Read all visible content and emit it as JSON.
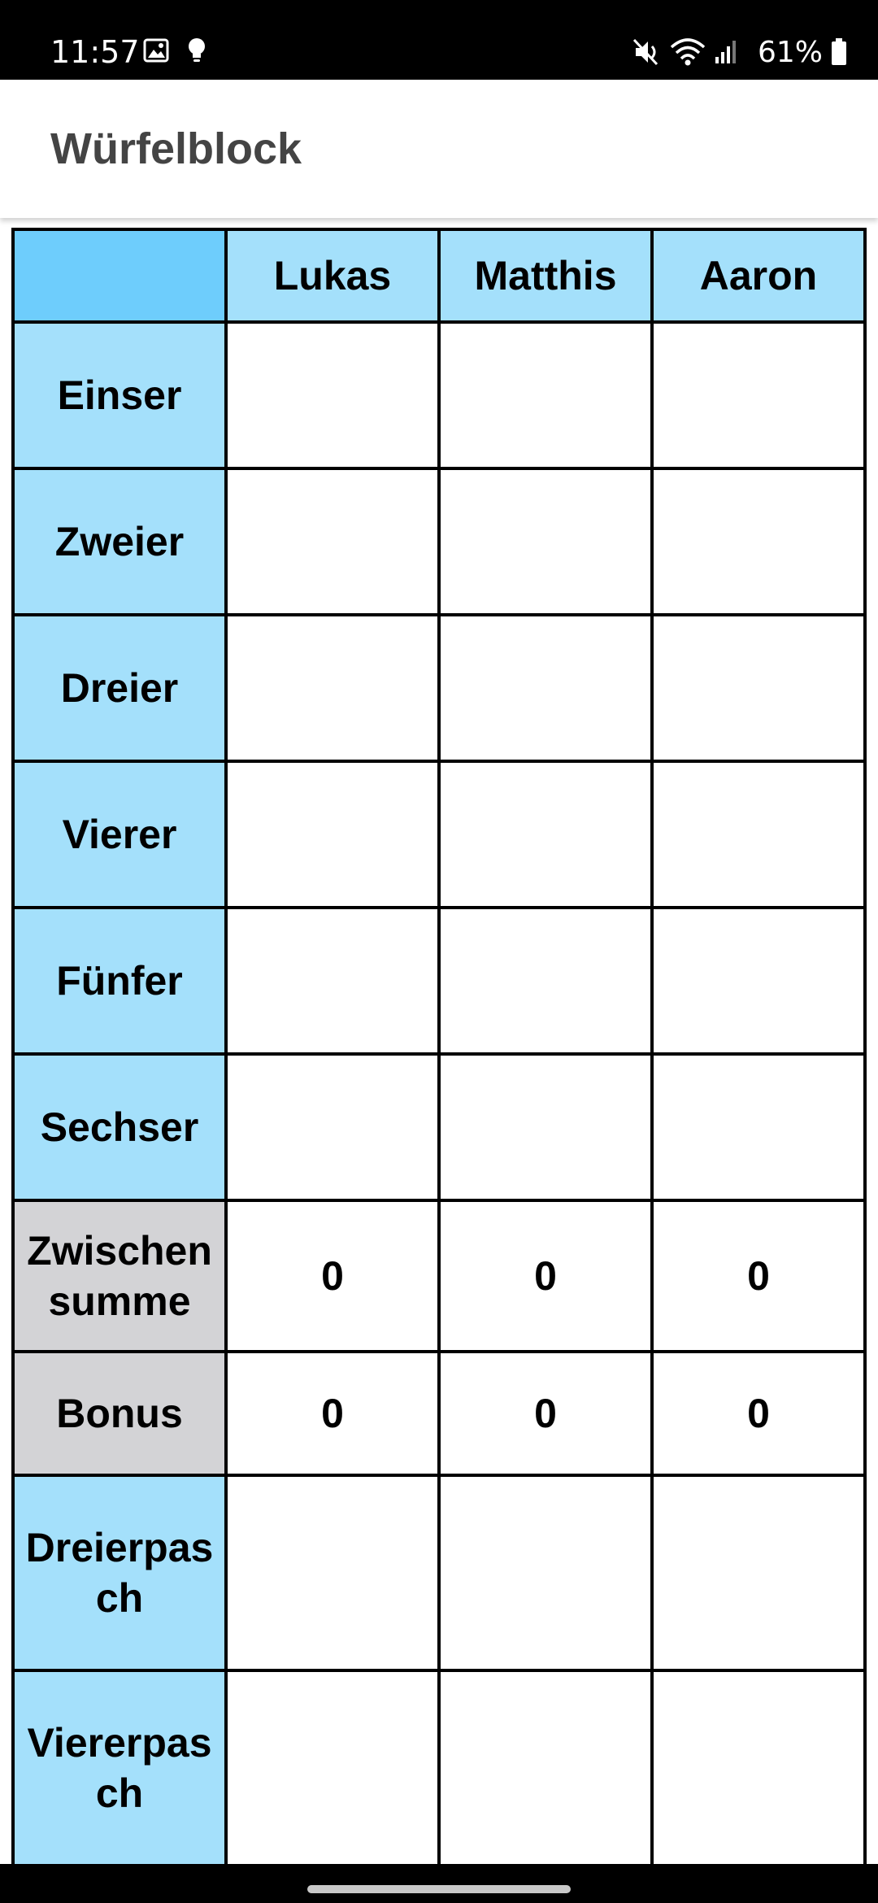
{
  "status_bar": {
    "time": "11:57",
    "battery": "61%",
    "icons": [
      "image-icon",
      "bulb-icon",
      "mute-icon",
      "wifi-icon",
      "signal-icon",
      "battery-icon"
    ]
  },
  "app_bar": {
    "title": "Würfelblock"
  },
  "table": {
    "players": [
      "Lukas",
      "Matthis",
      "Aaron"
    ],
    "rows": [
      {
        "label": "Einser",
        "values": [
          "",
          "",
          ""
        ]
      },
      {
        "label": "Zweier",
        "values": [
          "",
          "",
          ""
        ]
      },
      {
        "label": "Dreier",
        "values": [
          "",
          "",
          ""
        ]
      },
      {
        "label": "Vierer",
        "values": [
          "",
          "",
          ""
        ]
      },
      {
        "label": "Fünfer",
        "values": [
          "",
          "",
          ""
        ]
      },
      {
        "label": "Sechser",
        "values": [
          "",
          "",
          ""
        ]
      },
      {
        "label_line1": "Zwischen",
        "label_line2": "summe",
        "values": [
          "0",
          "0",
          "0"
        ]
      },
      {
        "label": "Bonus",
        "values": [
          "0",
          "0",
          "0"
        ]
      },
      {
        "label_line1": "Dreierpas",
        "label_line2": "ch",
        "values": [
          "",
          "",
          ""
        ]
      },
      {
        "label_line1": "Viererpas",
        "label_line2": "ch",
        "values": [
          "",
          "",
          ""
        ]
      }
    ]
  },
  "colors": {
    "header_corner": "#6ecdfc",
    "header_light_blue": "#a4e0fb",
    "summary_gray": "#d3d3d6",
    "sum_text": "#999999"
  }
}
